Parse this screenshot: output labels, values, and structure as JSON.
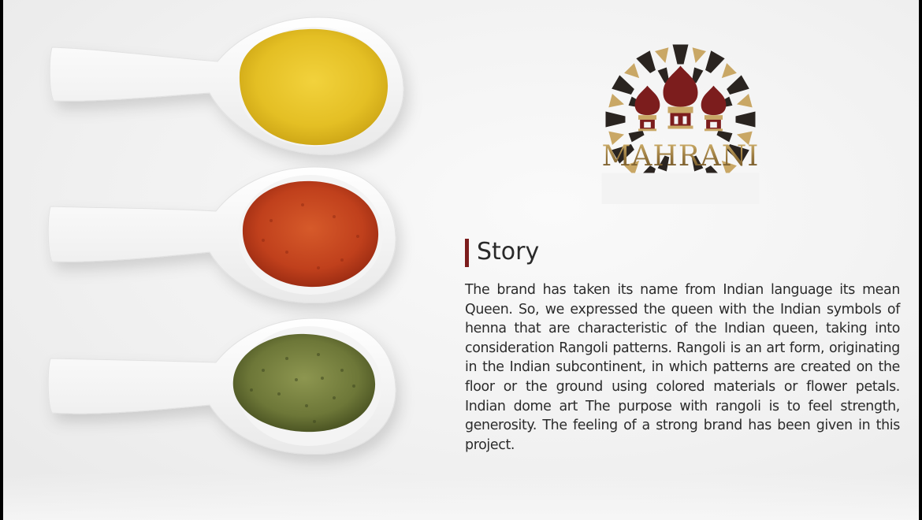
{
  "brand": {
    "name": "MAHRANI"
  },
  "story": {
    "heading": "Story",
    "body": "The brand has taken its name from Indian language its mean Queen. So, we expressed the queen with the Indian symbols of henna that are characteristic of the Indian queen, taking into consideration Rangoli patterns. Rangoli is an art form, originating in the Indian subcontinent, in which patterns are created on the floor or the ground using colored materials or flower petals. Indian dome art The purpose with rangoli is to feel strength, generosity. The feeling of a strong brand has been given in this project."
  },
  "colors": {
    "accent_maroon": "#7c1d1d",
    "gold": "#c9a765",
    "turmeric": "#e6c22a",
    "chili": "#c8461f",
    "herb": "#6f7a3d"
  },
  "images": {
    "spoons": [
      "turmeric-spoon",
      "chili-powder-spoon",
      "dried-herb-spoon"
    ]
  }
}
